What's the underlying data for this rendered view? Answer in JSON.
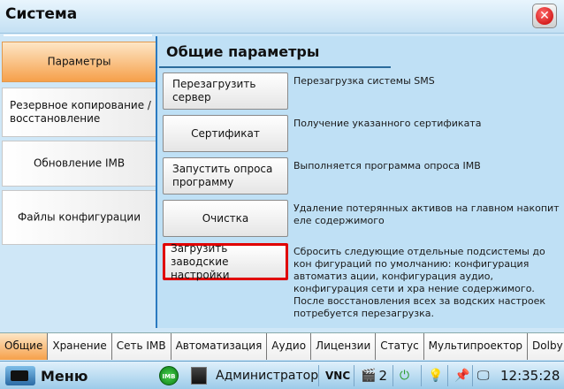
{
  "window": {
    "title": "Система",
    "close_glyph": "✕"
  },
  "left_tabs": [
    {
      "label": "Параметры",
      "active": true
    },
    {
      "label": "Резервное копирование / восстановление"
    },
    {
      "label": "Обновление IMB"
    },
    {
      "label": "Файлы конфигурации"
    }
  ],
  "content": {
    "heading": "Общие параметры",
    "actions": [
      {
        "button": "Перезагрузить сервер",
        "description": "Перезагрузка системы SMS"
      },
      {
        "button": "Сертификат",
        "description": "Получение указанного сертификата"
      },
      {
        "button": "Запустить опроса программу",
        "description": "Выполняется программа опроса IMB"
      },
      {
        "button": "Очистка",
        "description": "Удаление потерянных активов на главном накопит еле содержимого"
      },
      {
        "button": "Загрузить заводские настройки",
        "description": "Сбросить следующие отдельные подсистемы до кон фигураций по умолчанию:  конфигурация автоматиз ации, конфигурация аудио, конфигурация сети и хра нение содержимого. После восстановления всех за водских настроек потребуется перезагрузка."
      }
    ]
  },
  "bottom_tabs": [
    {
      "label": "Общие",
      "active": true
    },
    {
      "label": "Хранение"
    },
    {
      "label": "Сеть IMB"
    },
    {
      "label": "Автоматизация"
    },
    {
      "label": "Аудио"
    },
    {
      "label": "Лицензии"
    },
    {
      "label": "Статус"
    },
    {
      "label": "Мультипроектор"
    },
    {
      "label": "Dolby At"
    }
  ],
  "taskbar": {
    "menu_label": "Меню",
    "imb_badge": "IMB",
    "user": "Администратор",
    "vnc": "VNC",
    "count": "2",
    "clock": "12:35:28",
    "icons": [
      "menu-icon",
      "imb-icon",
      "device-icon",
      "clapper-icon",
      "power-icon",
      "bulb-icon",
      "pin-icon",
      "monitor-icon"
    ]
  }
}
